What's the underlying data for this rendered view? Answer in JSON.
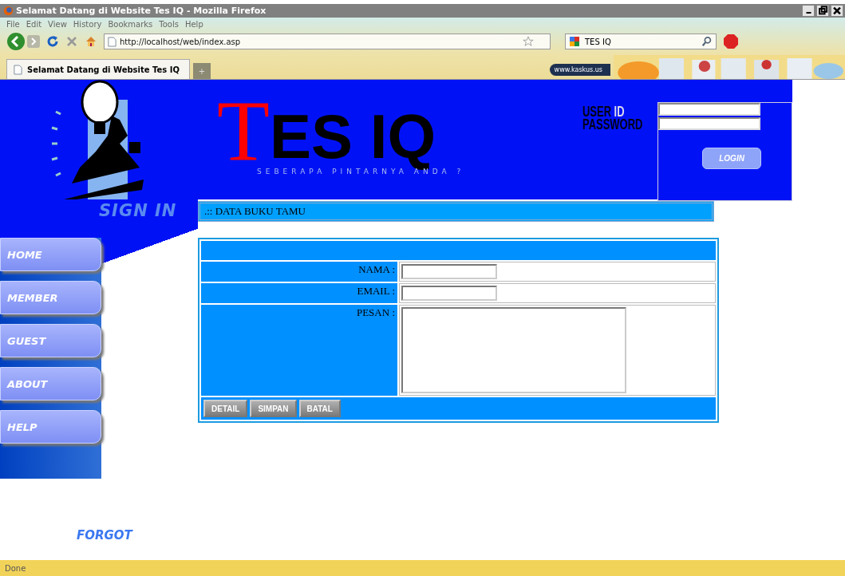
{
  "window": {
    "title": "Selamat Datang di Website Tes IQ - Mozilla Firefox"
  },
  "menu": [
    "File",
    "Edit",
    "View",
    "History",
    "Bookmarks",
    "Tools",
    "Help"
  ],
  "toolbar": {
    "url": "http://localhost/web/index.asp",
    "search": "TES IQ",
    "ad_link": "www.kaskus.us"
  },
  "tabs": [
    {
      "label": "Selamat Datang di Website Tes IQ",
      "selected": true
    }
  ],
  "new_tab": "+",
  "header": {
    "logo_big": "T",
    "logo_rest": "ES IQ",
    "tagline": "SEBERAPA PINTARNYA ANDA ?"
  },
  "login": {
    "user_label_dark": "USER",
    "user_label_light": "ID",
    "password_label": "PASSWORD",
    "button": "LOGIN"
  },
  "sidebar": {
    "sign_in": "SIGN IN",
    "items": [
      "HOME",
      "MEMBER",
      "GUEST",
      "ABOUT",
      "HELP"
    ],
    "forgot": "FORGOT"
  },
  "section_title": ".:: DATA BUKU TAMU",
  "form": {
    "fields": [
      {
        "label": "NAMA :",
        "kind": "text"
      },
      {
        "label": "EMAIL :",
        "kind": "text"
      },
      {
        "label": "PESAN :",
        "kind": "textarea"
      }
    ],
    "buttons": [
      "DETAIL",
      "SIMPAN",
      "BATAL"
    ]
  },
  "status_bar": "Done"
}
